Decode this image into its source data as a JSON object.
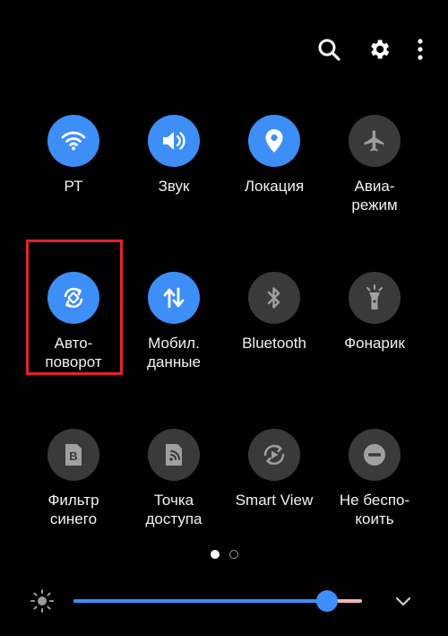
{
  "topbar": {
    "icons": [
      "search-icon",
      "gear-icon",
      "more-vert-icon"
    ]
  },
  "tiles": [
    {
      "label": "РТ",
      "icon": "wifi-icon",
      "active": true
    },
    {
      "label": "Звук",
      "icon": "volume-icon",
      "active": true
    },
    {
      "label": "Локация",
      "icon": "location-pin-icon",
      "active": true
    },
    {
      "label": "Авиа-\nрежим",
      "icon": "airplane-icon",
      "active": false
    },
    {
      "label": "Авто-\nповорот",
      "icon": "auto-rotate-icon",
      "active": true,
      "highlighted": true
    },
    {
      "label": "Мобил.\nданные",
      "icon": "mobile-data-icon",
      "active": true
    },
    {
      "label": "Bluetooth",
      "icon": "bluetooth-icon",
      "active": false
    },
    {
      "label": "Фонарик",
      "icon": "flashlight-icon",
      "active": false
    },
    {
      "label": "Фильтр\nсинего",
      "icon": "blue-light-filter-icon",
      "active": false
    },
    {
      "label": "Точка\nдоступа",
      "icon": "hotspot-icon",
      "active": false
    },
    {
      "label": "Smart View",
      "icon": "smart-view-icon",
      "active": false
    },
    {
      "label": "Не беспо-\nкоить",
      "icon": "do-not-disturb-icon",
      "active": false
    }
  ],
  "pager": {
    "pages": 2,
    "current": 1
  },
  "brightness": {
    "level": 0.88
  },
  "colors": {
    "accent": "#3e8ef7",
    "tile_off": "#3a3a3a",
    "highlight": "#e5222a",
    "background": "#000000"
  }
}
